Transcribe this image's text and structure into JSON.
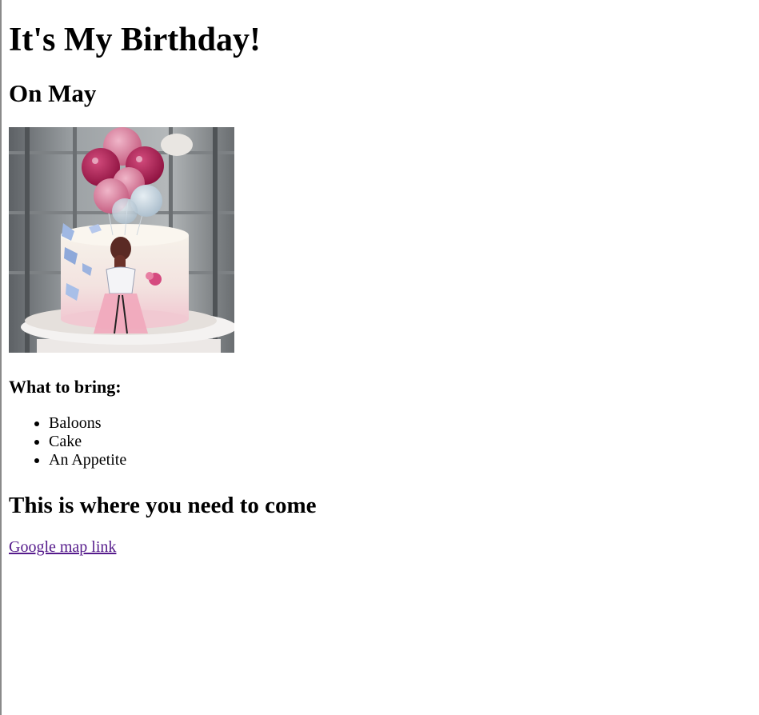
{
  "header": {
    "title": "It's My Birthday!",
    "date": "On May"
  },
  "image": {
    "alt": "Birthday cake with balloons"
  },
  "bring": {
    "heading": "What to bring:",
    "items": [
      "Baloons",
      "Cake",
      "An Appetite"
    ]
  },
  "location": {
    "heading": "This is where you need to come",
    "link_text": "Google map link"
  },
  "colors": {
    "link_visited": "#551a8b",
    "text": "#000000",
    "background": "#ffffff"
  }
}
